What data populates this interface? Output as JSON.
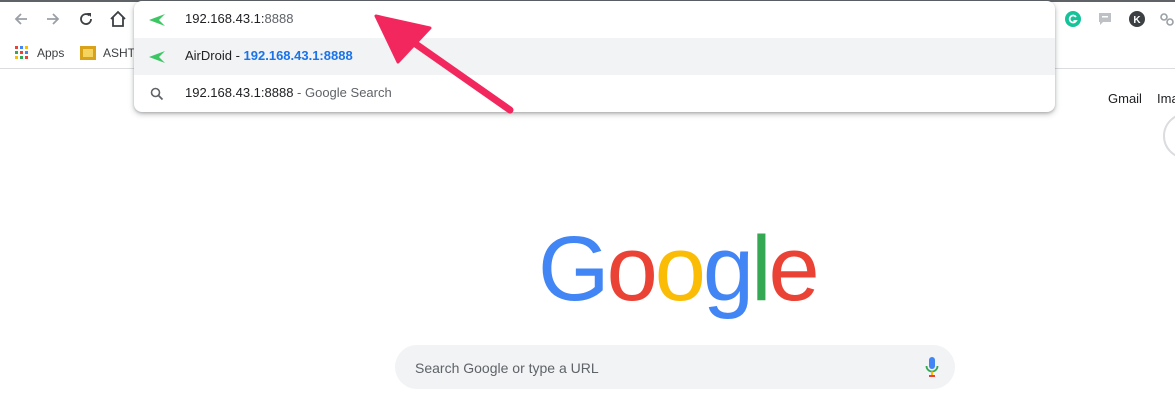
{
  "bookmarks": {
    "apps_label": "Apps",
    "second_label": "ASHT"
  },
  "omnibox": {
    "input_typed": "192.168.43.1:",
    "input_autocomplete": "8888",
    "suggestion": {
      "title": "AirDroid",
      "separator": " - ",
      "url": "192.168.43.1:8888"
    },
    "search_row": {
      "query": "192.168.43.1:8888",
      "suffix": " - Google Search"
    }
  },
  "header_links": {
    "gmail": "Gmail",
    "images": "Ima"
  },
  "logo_letters": [
    "G",
    "o",
    "o",
    "g",
    "l",
    "e"
  ],
  "search": {
    "placeholder": "Search Google or type a URL"
  },
  "colors": {
    "google_blue": "#4285F4",
    "google_red": "#EA4335",
    "google_yellow": "#FBBC05",
    "google_green": "#34A853",
    "arrow_pink": "#F2275D",
    "airdroid_green": "#3DC664"
  },
  "icons": [
    "back-icon",
    "forward-icon",
    "reload-icon",
    "home-icon",
    "apps-grid-icon",
    "airdroid-icon",
    "search-icon",
    "grammarly-icon",
    "feedback-icon",
    "profile-k-icon",
    "extension-icon",
    "mic-icon"
  ]
}
